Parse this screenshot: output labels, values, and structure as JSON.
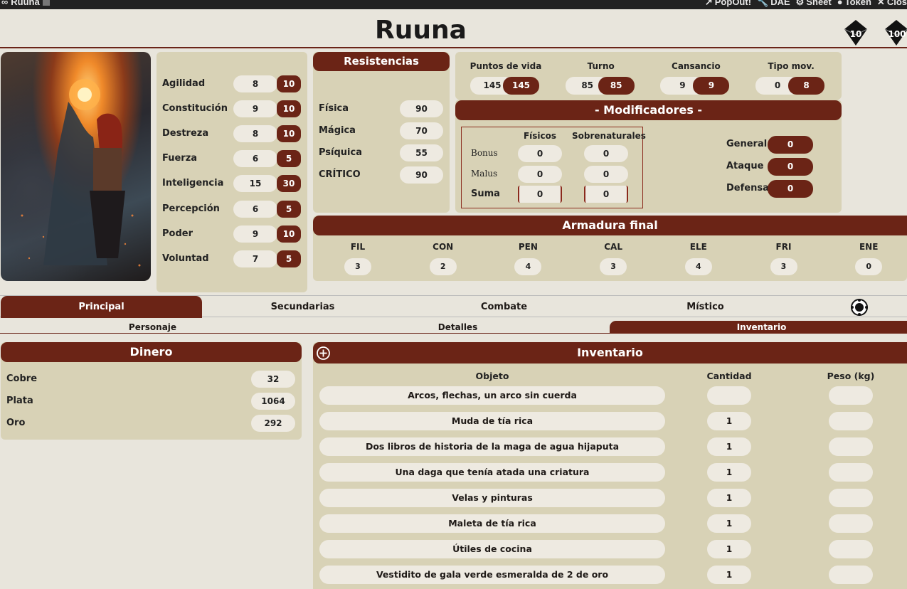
{
  "titlebar": {
    "title": "Ruuna",
    "buttons": [
      "PopOut!",
      "DAE",
      "Sheet",
      "Token",
      "Clos"
    ]
  },
  "character": {
    "name": "Ruuna"
  },
  "dice": [
    "10",
    "100"
  ],
  "attributes": [
    {
      "label": "Agilidad",
      "base": "8",
      "final": "10"
    },
    {
      "label": "Constitución",
      "base": "9",
      "final": "10"
    },
    {
      "label": "Destreza",
      "base": "8",
      "final": "10"
    },
    {
      "label": "Fuerza",
      "base": "6",
      "final": "5"
    },
    {
      "label": "Inteligencia",
      "base": "15",
      "final": "30"
    },
    {
      "label": "Percepción",
      "base": "6",
      "final": "5"
    },
    {
      "label": "Poder",
      "base": "9",
      "final": "10"
    },
    {
      "label": "Voluntad",
      "base": "7",
      "final": "5"
    }
  ],
  "resistencias": {
    "title": "Resistencias",
    "items": [
      {
        "label": "Física",
        "value": "90"
      },
      {
        "label": "Mágica",
        "value": "70"
      },
      {
        "label": "Psíquica",
        "value": "55"
      },
      {
        "label": "CRÍTICO",
        "value": "90"
      }
    ]
  },
  "stats": [
    {
      "label": "Puntos de vida",
      "base": "145",
      "final": "145"
    },
    {
      "label": "Turno",
      "base": "85",
      "final": "85"
    },
    {
      "label": "Cansancio",
      "base": "9",
      "final": "9"
    },
    {
      "label": "Tipo mov.",
      "base": "0",
      "final": "8"
    }
  ],
  "modificadores": {
    "title": "- Modificadores -",
    "col_fisicos": "Físicos",
    "col_sobre": "Sobrenaturales",
    "rows": [
      {
        "label": "Bonus",
        "fisicos": "0",
        "sobre": "0"
      },
      {
        "label": "Malus",
        "fisicos": "0",
        "sobre": "0"
      },
      {
        "label": "Suma",
        "fisicos": "0",
        "sobre": "0"
      }
    ],
    "right": [
      {
        "label": "General",
        "value": "0"
      },
      {
        "label": "Ataque",
        "value": "0"
      },
      {
        "label": "Defensa",
        "value": "0"
      }
    ]
  },
  "armadura": {
    "title": "Armadura final",
    "items": [
      {
        "label": "FIL",
        "value": "3"
      },
      {
        "label": "CON",
        "value": "2"
      },
      {
        "label": "PEN",
        "value": "4"
      },
      {
        "label": "CAL",
        "value": "3"
      },
      {
        "label": "ELE",
        "value": "4"
      },
      {
        "label": "FRI",
        "value": "3"
      },
      {
        "label": "ENE",
        "value": "0"
      }
    ]
  },
  "tabs": [
    "Principal",
    "Secundarias",
    "Combate",
    "Místico"
  ],
  "subtabs": [
    "Personaje",
    "Detalles",
    "Inventario"
  ],
  "dinero": {
    "title": "Dinero",
    "items": [
      {
        "label": "Cobre",
        "value": "32"
      },
      {
        "label": "Plata",
        "value": "1064"
      },
      {
        "label": "Oro",
        "value": "292"
      }
    ]
  },
  "inventario": {
    "title": "Inventario",
    "col_obj": "Objeto",
    "col_qty": "Cantidad",
    "col_wt": "Peso (kg)",
    "items": [
      {
        "name": "Arcos, flechas, un arco sin cuerda",
        "qty": "",
        "wt": ""
      },
      {
        "name": "Muda de tía rica",
        "qty": "1",
        "wt": ""
      },
      {
        "name": "Dos libros de historia de la maga de agua hijaputa",
        "qty": "1",
        "wt": ""
      },
      {
        "name": "Una daga que tenía atada una criatura",
        "qty": "1",
        "wt": ""
      },
      {
        "name": "Velas y pinturas",
        "qty": "1",
        "wt": ""
      },
      {
        "name": "Maleta de tía rica",
        "qty": "1",
        "wt": ""
      },
      {
        "name": "Útiles de cocina",
        "qty": "1",
        "wt": ""
      },
      {
        "name": "Vestidito de gala verde esmeralda de 2 de oro",
        "qty": "1",
        "wt": ""
      }
    ]
  }
}
